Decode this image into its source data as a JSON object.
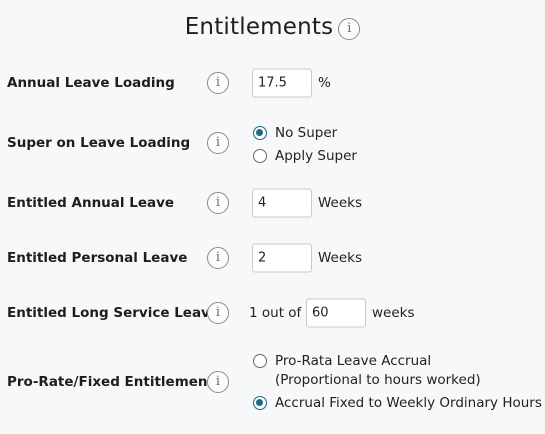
{
  "title": "Entitlements",
  "info_glyph": "i",
  "annual_leave_loading": {
    "label": "Annual Leave Loading",
    "value": "17.5",
    "unit": "%"
  },
  "super_on_leave_loading": {
    "label": "Super on Leave Loading",
    "options": [
      {
        "label": "No Super",
        "selected": true
      },
      {
        "label": "Apply Super",
        "selected": false
      }
    ]
  },
  "entitled_annual_leave": {
    "label": "Entitled Annual Leave",
    "value": "4",
    "unit": "Weeks"
  },
  "entitled_personal_leave": {
    "label": "Entitled Personal Leave",
    "value": "2",
    "unit": "Weeks"
  },
  "entitled_long_service_leave": {
    "label": "Entitled Long Service Leave",
    "prefix": "1 out of",
    "value": "60",
    "unit": "weeks"
  },
  "pro_rate_fixed": {
    "label": "Pro-Rate/Fixed Entitlements",
    "options": [
      {
        "label": "Pro-Rata Leave Accrual",
        "sublabel": "(Proportional to hours worked)",
        "selected": false
      },
      {
        "label": "Accrual Fixed to Weekly Ordinary Hours",
        "selected": true
      }
    ]
  },
  "colors": {
    "accent": "#1a6b86",
    "background": "#f6f8f9"
  }
}
